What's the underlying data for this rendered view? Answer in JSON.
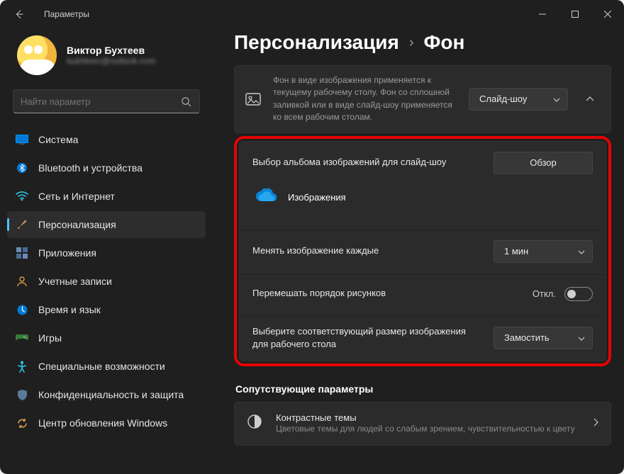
{
  "window": {
    "title": "Параметры"
  },
  "profile": {
    "name": "Виктор Бухтеев",
    "sub": "bukhteev@outlook.com"
  },
  "search": {
    "placeholder": "Найти параметр"
  },
  "nav": [
    {
      "key": "system",
      "label": "Система"
    },
    {
      "key": "bluetooth",
      "label": "Bluetooth и устройства"
    },
    {
      "key": "network",
      "label": "Сеть и Интернет"
    },
    {
      "key": "personalization",
      "label": "Персонализация"
    },
    {
      "key": "apps",
      "label": "Приложения"
    },
    {
      "key": "accounts",
      "label": "Учетные записи"
    },
    {
      "key": "time",
      "label": "Время и язык"
    },
    {
      "key": "gaming",
      "label": "Игры"
    },
    {
      "key": "accessibility",
      "label": "Специальные возможности"
    },
    {
      "key": "privacy",
      "label": "Конфиденциальность и защита"
    },
    {
      "key": "update",
      "label": "Центр обновления Windows"
    }
  ],
  "breadcrumb": {
    "root": "Персонализация",
    "page": "Фон"
  },
  "bgCard": {
    "desc": "Фон в виде изображения применяется к текущему рабочему столу. Фон со сплошной заливкой или в виде слайд-шоу применяется ко всем рабочим столам.",
    "select": "Слайд-шоу"
  },
  "settings": {
    "album_label": "Выбор альбома изображений для слайд-шоу",
    "browse": "Обзор",
    "album_name": "Изображения",
    "interval_label": "Менять изображение каждые",
    "interval_value": "1 мин",
    "shuffle_label": "Перемешать порядок рисунков",
    "shuffle_state": "Откл.",
    "fit_label": "Выберите соответствующий размер изображения для рабочего стола",
    "fit_value": "Замостить"
  },
  "related": {
    "section": "Сопутствующие параметры",
    "contrast_title": "Контрастные темы",
    "contrast_sub": "Цветовые темы для людей со слабым зрением, чувствительностью к цвету"
  }
}
